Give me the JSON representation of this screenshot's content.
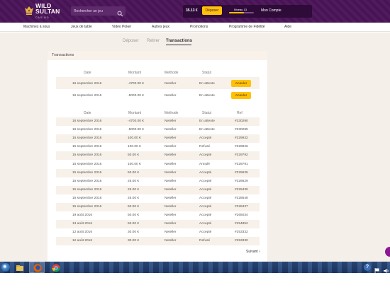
{
  "header": {
    "logo_line1": "WILD",
    "logo_line2": "SULTAN",
    "logo_sub": "CASINO",
    "search_placeholder": "Rechercher un jeu",
    "balance": "35.13 €",
    "deposit_label": "Déposer",
    "level_label": "Niveau 13",
    "level_progress": 0.6,
    "my_account": "Mon Compte"
  },
  "nav": {
    "items": [
      "Machines à sous",
      "Jeux de table",
      "Vidéo Poker",
      "Autres jeux",
      "Promotions",
      "Programme de Fidélité",
      "Aide"
    ]
  },
  "tabs": {
    "deposit": "Déposer",
    "withdraw": "Retirer",
    "transactions": "Transactions"
  },
  "panel": {
    "title": "Transactions"
  },
  "pending_table": {
    "headers": [
      "Date",
      "Montant",
      "Methode",
      "Statut"
    ],
    "rows": [
      {
        "date": "16 septembre 2016",
        "amount": "-4700.00 €",
        "method": "Neteller",
        "status": "En attente",
        "action": "Annuler"
      },
      {
        "date": "16 septembre 2016",
        "amount": "-5000.00 €",
        "method": "Neteller",
        "status": "En attente",
        "action": "Annuler"
      }
    ]
  },
  "history_table": {
    "headers": [
      "Date",
      "Montant",
      "Methode",
      "Statut",
      "Ref"
    ],
    "rows": [
      {
        "date": "16 septembre 2016",
        "amount": "-4700.00 €",
        "method": "Neteller",
        "status": "En attente",
        "ref": "#330290"
      },
      {
        "date": "16 septembre 2016",
        "amount": "-5000.00 €",
        "method": "Neteller",
        "status": "En attente",
        "ref": "#330285"
      },
      {
        "date": "15 septembre 2016",
        "amount": "100.00 €",
        "method": "Neteller",
        "status": "Accepté",
        "ref": "#329932"
      },
      {
        "date": "15 septembre 2016",
        "amount": "100.00 €",
        "method": "Neteller",
        "status": "Refusé",
        "ref": "#329926"
      },
      {
        "date": "15 septembre 2016",
        "amount": "50.00 €",
        "method": "Neteller",
        "status": "Accepté",
        "ref": "#329792"
      },
      {
        "date": "15 septembre 2016",
        "amount": "100.00 €",
        "method": "Neteller",
        "status": "Annulé",
        "ref": "#329791"
      },
      {
        "date": "15 septembre 2016",
        "amount": "50.00 €",
        "method": "Neteller",
        "status": "Accepté",
        "ref": "#329635"
      },
      {
        "date": "15 septembre 2016",
        "amount": "25.00 €",
        "method": "Neteller",
        "status": "Accepté",
        "ref": "#329529"
      },
      {
        "date": "15 septembre 2016",
        "amount": "25.00 €",
        "method": "Neteller",
        "status": "Accepté",
        "ref": "#329430"
      },
      {
        "date": "15 septembre 2016",
        "amount": "25.00 €",
        "method": "Neteller",
        "status": "Accepté",
        "ref": "#328648"
      },
      {
        "date": "15 septembre 2016",
        "amount": "50.00 €",
        "method": "Neteller",
        "status": "Accepté",
        "ref": "#328437"
      },
      {
        "date": "19 août 2016",
        "amount": "50.00 €",
        "method": "Neteller",
        "status": "Accepté",
        "ref": "#265034"
      },
      {
        "date": "13 août 2016",
        "amount": "50.00 €",
        "method": "Neteller",
        "status": "Accepté",
        "ref": "#254852"
      },
      {
        "date": "12 août 2016",
        "amount": "30.00 €",
        "method": "Neteller",
        "status": "Accepté",
        "ref": "#253332"
      },
      {
        "date": "12 août 2016",
        "amount": "30.00 €",
        "method": "Neteller",
        "status": "Refusé",
        "ref": "#253330"
      }
    ]
  },
  "pagination": {
    "next": "Suivant ›"
  },
  "taskbar": {
    "help_glyph": "?",
    "icons": [
      "windows-start-icon",
      "explorer-icon",
      "firefox-icon",
      "chrome-icon"
    ]
  },
  "colors": {
    "header_bg": "#4a1458",
    "accent": "#ffc107",
    "page_bg": "#f5efe9",
    "row_alt": "#f7f1ea"
  }
}
